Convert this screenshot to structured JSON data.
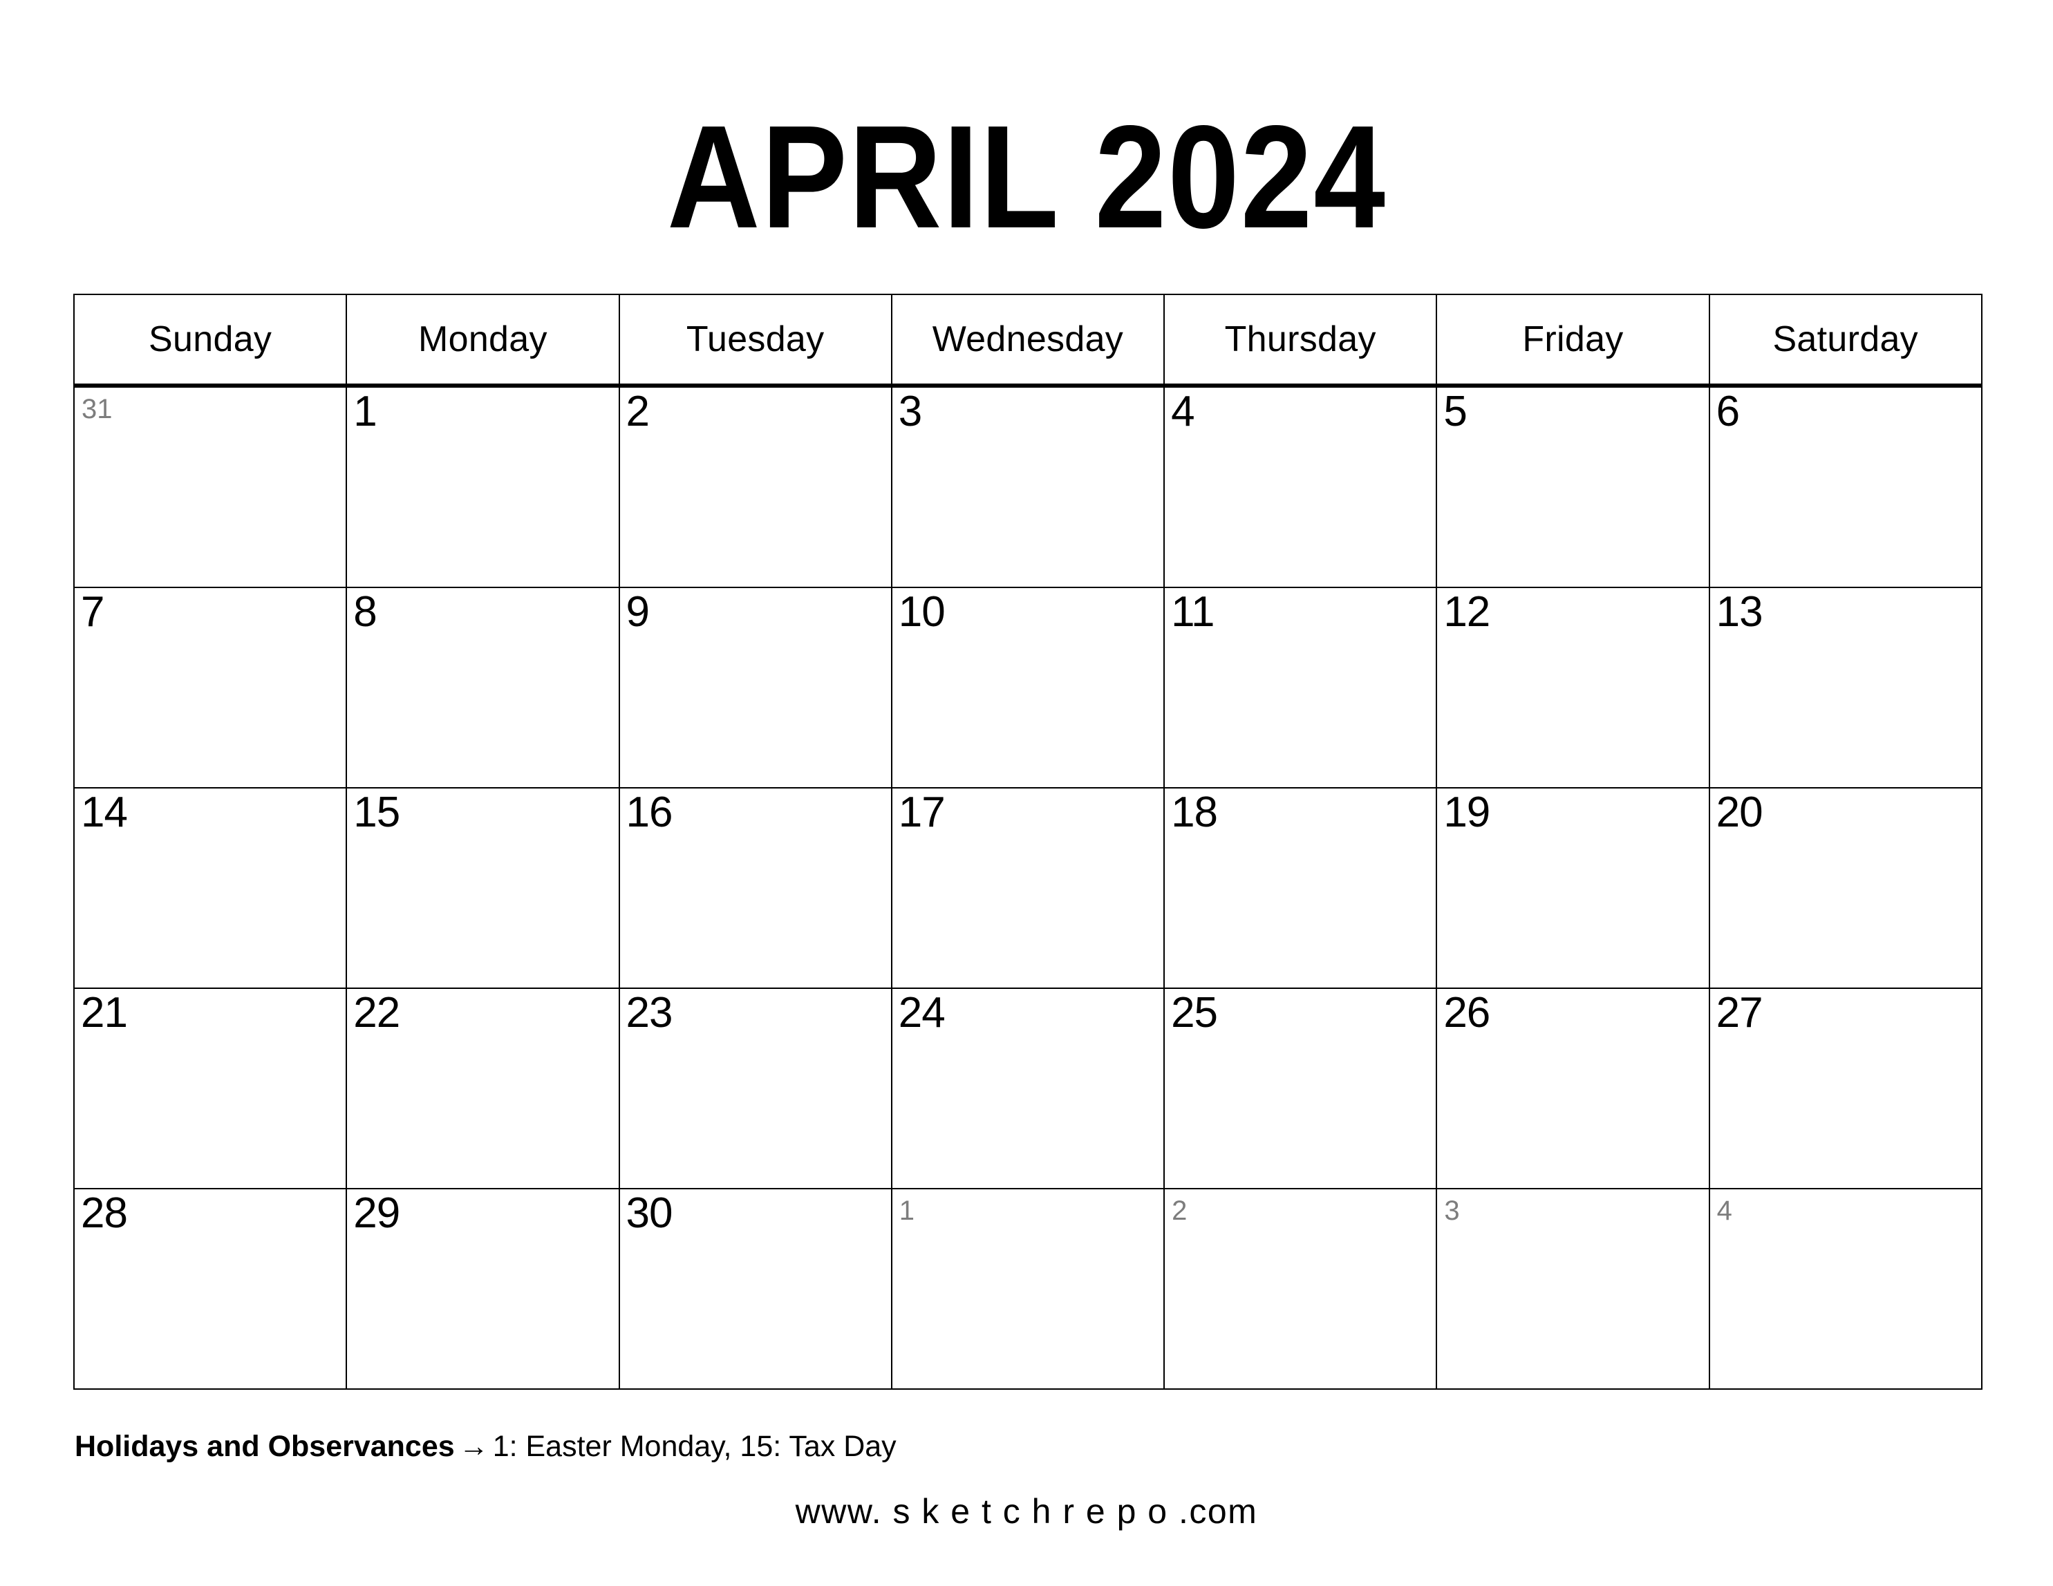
{
  "title": "APRIL 2024",
  "weekdays": [
    "Sunday",
    "Monday",
    "Tuesday",
    "Wednesday",
    "Thursday",
    "Friday",
    "Saturday"
  ],
  "weeks": [
    [
      {
        "num": "31",
        "muted": true
      },
      {
        "num": "1",
        "muted": false
      },
      {
        "num": "2",
        "muted": false
      },
      {
        "num": "3",
        "muted": false
      },
      {
        "num": "4",
        "muted": false
      },
      {
        "num": "5",
        "muted": false
      },
      {
        "num": "6",
        "muted": false
      }
    ],
    [
      {
        "num": "7",
        "muted": false
      },
      {
        "num": "8",
        "muted": false
      },
      {
        "num": "9",
        "muted": false
      },
      {
        "num": "10",
        "muted": false
      },
      {
        "num": "11",
        "muted": false
      },
      {
        "num": "12",
        "muted": false
      },
      {
        "num": "13",
        "muted": false
      }
    ],
    [
      {
        "num": "14",
        "muted": false
      },
      {
        "num": "15",
        "muted": false
      },
      {
        "num": "16",
        "muted": false
      },
      {
        "num": "17",
        "muted": false
      },
      {
        "num": "18",
        "muted": false
      },
      {
        "num": "19",
        "muted": false
      },
      {
        "num": "20",
        "muted": false
      }
    ],
    [
      {
        "num": "21",
        "muted": false
      },
      {
        "num": "22",
        "muted": false
      },
      {
        "num": "23",
        "muted": false
      },
      {
        "num": "24",
        "muted": false
      },
      {
        "num": "25",
        "muted": false
      },
      {
        "num": "26",
        "muted": false
      },
      {
        "num": "27",
        "muted": false
      }
    ],
    [
      {
        "num": "28",
        "muted": false
      },
      {
        "num": "29",
        "muted": false
      },
      {
        "num": "30",
        "muted": false
      },
      {
        "num": "1",
        "muted": true
      },
      {
        "num": "2",
        "muted": true
      },
      {
        "num": "3",
        "muted": true
      },
      {
        "num": "4",
        "muted": true
      }
    ]
  ],
  "footer": {
    "holidays_label": "Holidays and Observances",
    "holidays_arrow": "→",
    "holidays_list": "1: Easter Monday, 15: Tax Day",
    "website": "www. s k e t c h r e p o .com"
  },
  "colors": {
    "text": "#000000",
    "muted_text": "#7d7d7d",
    "grid_line": "#000000",
    "background": "#ffffff"
  }
}
